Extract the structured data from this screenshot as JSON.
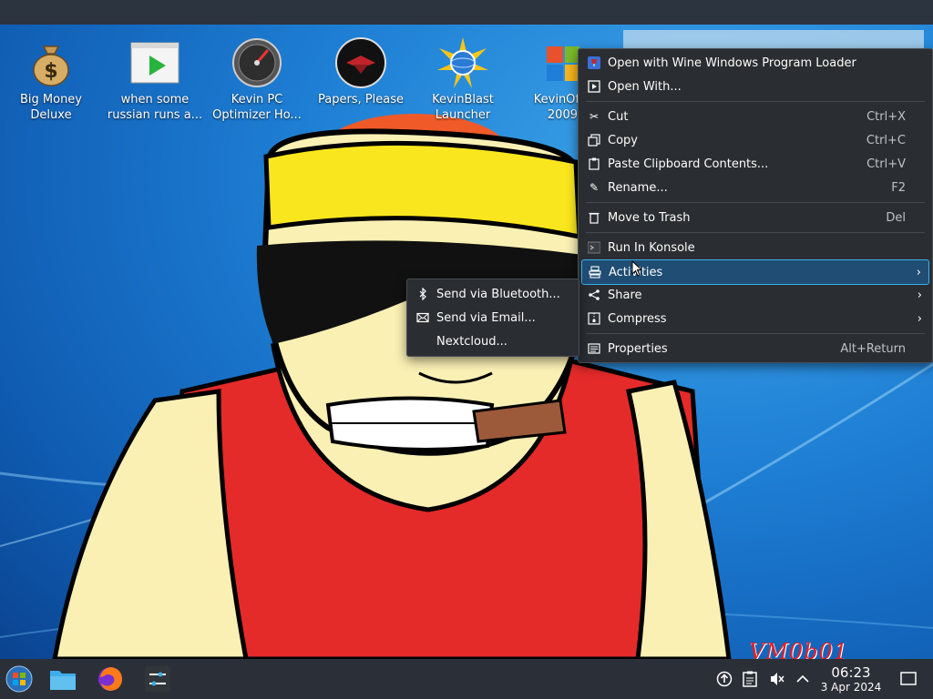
{
  "desktop": {
    "icons": [
      {
        "label1": "Big Money",
        "label2": "Deluxe",
        "icon": "money-bag-icon"
      },
      {
        "label1": "when some",
        "label2": "russian runs a...",
        "icon": "video-player-icon"
      },
      {
        "label1": "Kevin PC",
        "label2": "Optimizer Ho...",
        "icon": "gauge-icon"
      },
      {
        "label1": "Papers, Please",
        "label2": "",
        "icon": "eagle-emblem-icon"
      },
      {
        "label1": "KevinBlast",
        "label2": "Launcher",
        "icon": "globe-burst-icon"
      },
      {
        "label1": "KevinOf",
        "label2": "2009",
        "icon": "office-icon"
      }
    ],
    "watermark": "VM0b01"
  },
  "context_menu": {
    "items": [
      {
        "label": "Open with Wine Windows Program Loader",
        "shortcut": "",
        "icon": "wine-icon"
      },
      {
        "label": "Open With...",
        "shortcut": "",
        "icon": "open-with-icon"
      },
      {
        "label": "Cut",
        "shortcut": "Ctrl+X",
        "icon": "scissors-icon"
      },
      {
        "label": "Copy",
        "shortcut": "Ctrl+C",
        "icon": "copy-icon"
      },
      {
        "label": "Paste Clipboard Contents...",
        "shortcut": "Ctrl+V",
        "icon": "paste-icon"
      },
      {
        "label": "Rename...",
        "shortcut": "F2",
        "icon": "pencil-icon"
      },
      {
        "label": "Move to Trash",
        "shortcut": "Del",
        "icon": "trash-icon"
      },
      {
        "label": "Run In Konsole",
        "shortcut": "",
        "icon": "terminal-icon"
      },
      {
        "label": "Activities",
        "shortcut": "",
        "icon": "activities-icon"
      },
      {
        "label": "Share",
        "shortcut": "",
        "icon": "share-icon"
      },
      {
        "label": "Compress",
        "shortcut": "",
        "icon": "compress-icon"
      },
      {
        "label": "Properties",
        "shortcut": "Alt+Return",
        "icon": "properties-icon"
      }
    ]
  },
  "submenu": {
    "items": [
      {
        "label": "Send via Bluetooth...",
        "icon": "bluetooth-icon"
      },
      {
        "label": "Send via Email...",
        "icon": "email-icon"
      },
      {
        "label": "Nextcloud...",
        "icon": ""
      }
    ]
  },
  "taskbar": {
    "time": "06:23",
    "date": "3 Apr 2024"
  },
  "colors": {
    "menu_bg": "#2a2e32",
    "highlight": "#3daee9",
    "taskbar_bg": "#2b3038"
  }
}
